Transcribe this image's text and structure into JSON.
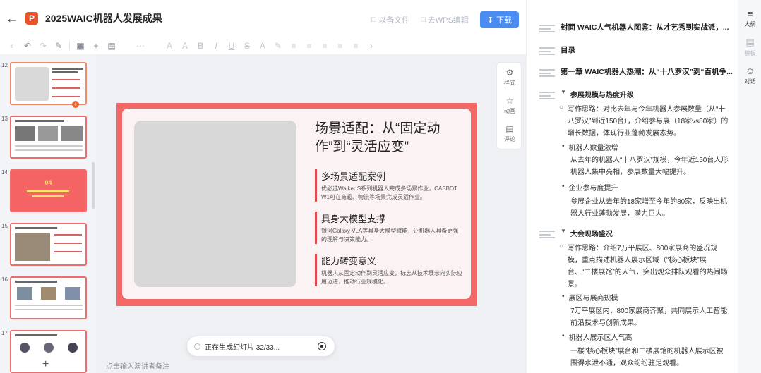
{
  "header": {
    "back_icon": "arrow-left-icon",
    "logo_letter": "P",
    "title": "2025WAIC机器人发展成果",
    "link1": "以备文件",
    "link2": "去WPS编辑",
    "download": "下载"
  },
  "thumbs": [
    {
      "num": "12",
      "active": true
    },
    {
      "num": "13"
    },
    {
      "num": "14",
      "label_num": "04"
    },
    {
      "num": "15"
    },
    {
      "num": "16"
    },
    {
      "num": "17"
    }
  ],
  "slide": {
    "title": "场景适配：从“固定动作”到“灵活应变”",
    "points": [
      {
        "heading": "多场景适配案例",
        "text": "优必选Walker S系列机器人完成多场景作业，CASBOT W1可在商超、物流等场景完成灵活作业。"
      },
      {
        "heading": "具身大模型支撑",
        "text": "银河Galaxy VLA等具身大模型赋能，让机器人具备更强的理解与决策能力。"
      },
      {
        "heading": "能力转变意义",
        "text": "机器人从固定动作到灵活应变，标志从技术展示向实际应用迈进，推动行业规模化。"
      }
    ]
  },
  "side_tools": {
    "style_label": "样式",
    "anim_label": "动画",
    "comment_label": "评论"
  },
  "generating": "正在生成幻灯片 32/33...",
  "notes_placeholder": "点击输入演讲者备注",
  "outline": {
    "cover": "封面 WAIC人气机器人图鉴：从才艺秀到实战派，...",
    "toc": "目录",
    "chapter1": "第一章 WAIC机器人热潮：从“十八罗汉”到“百机争...",
    "sec1": "参展规模与热度升级",
    "sec1_intro": "写作思路：对比去年与今年机器人参展数量（从“十八罗汉”到近150台），介绍参与展（18家vs80家）的增长数据，体现行业蓬勃发展态势。",
    "sec1_b1": "机器人数量激增",
    "sec1_b1_t": "从去年的机器人“十八罗汉”规模，今年近150台人形机器人集中亮相，参展数量大幅提升。",
    "sec1_b2": "企业参与度提升",
    "sec1_b2_t": "参展企业从去年的18家增至今年的80家，反映出机器人行业蓬勃发展，潜力巨大。",
    "sec2": "大会现场盛况",
    "sec2_intro": "写作思路：介绍7万平展区、800家展商的盛况规模，重点描述机器人展示区域（“核心板块”展台、“二楼展馆”的人气，突出观众排队观看的热闹场景。",
    "sec2_b1": "展区与展商规模",
    "sec2_b1_t": "7万平展区内，800家展商齐聚，共同展示人工智能前沿技术与创新成果。",
    "sec2_b2": "机器人展示区人气高",
    "sec2_b2_t": "一楼“核心板块”展台和二楼展馆的机器人展示区被围得水泄不通，观众纷纷驻足观看。"
  },
  "rail": {
    "outline": "大纲",
    "template": "模板",
    "chat": "对话"
  }
}
